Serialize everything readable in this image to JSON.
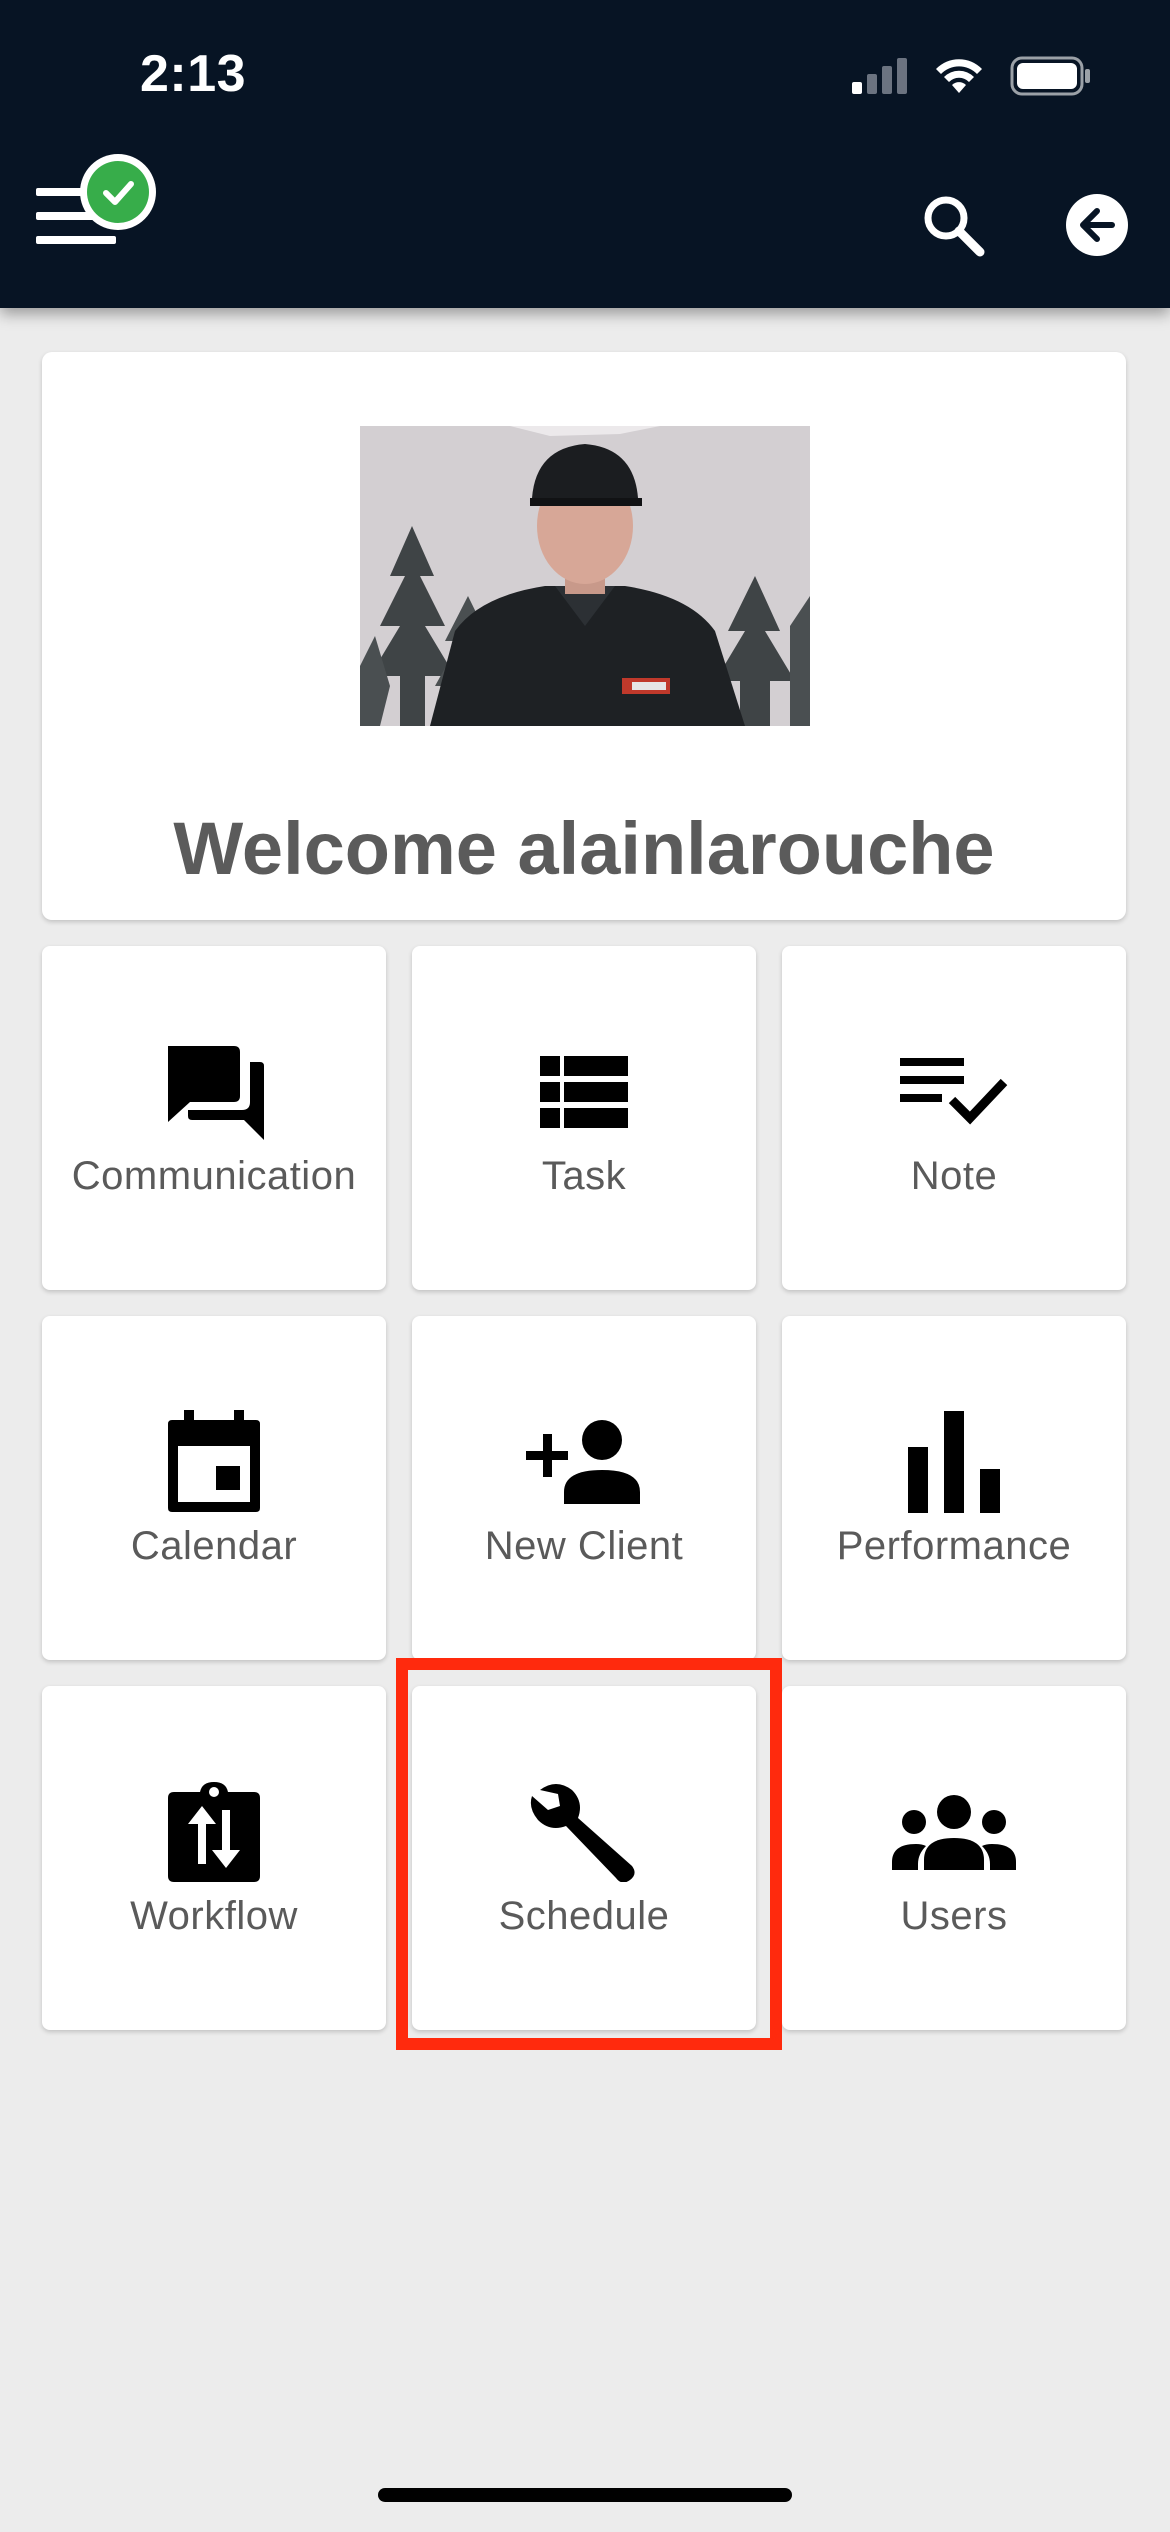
{
  "status_bar": {
    "time": "2:13"
  },
  "toolbar": {
    "menu_icon": "hamburger-menu-icon",
    "sync_status_icon": "check-circle-icon",
    "search_icon": "search-icon",
    "back_icon": "arrow-left-circle-icon"
  },
  "welcome": {
    "title": "Welcome alainlarouche",
    "avatar_alt": "user profile photo"
  },
  "tiles": [
    {
      "label": "Communication",
      "icon": "forum-icon"
    },
    {
      "label": "Task",
      "icon": "view-list-icon"
    },
    {
      "label": "Note",
      "icon": "playlist-check-icon"
    },
    {
      "label": "Calendar",
      "icon": "calendar-event-icon"
    },
    {
      "label": "New Client",
      "icon": "person-add-icon"
    },
    {
      "label": "Performance",
      "icon": "bar-chart-icon"
    },
    {
      "label": "Workflow",
      "icon": "clipboard-swap-icon"
    },
    {
      "label": "Schedule",
      "icon": "wrench-icon"
    },
    {
      "label": "Users",
      "icon": "group-icon"
    }
  ],
  "colors": {
    "app_bar": "#071424",
    "background": "#ececec",
    "tile_text": "#5a5a5a",
    "sync_green": "#37ad4a",
    "highlight": "#ff2a0d"
  }
}
